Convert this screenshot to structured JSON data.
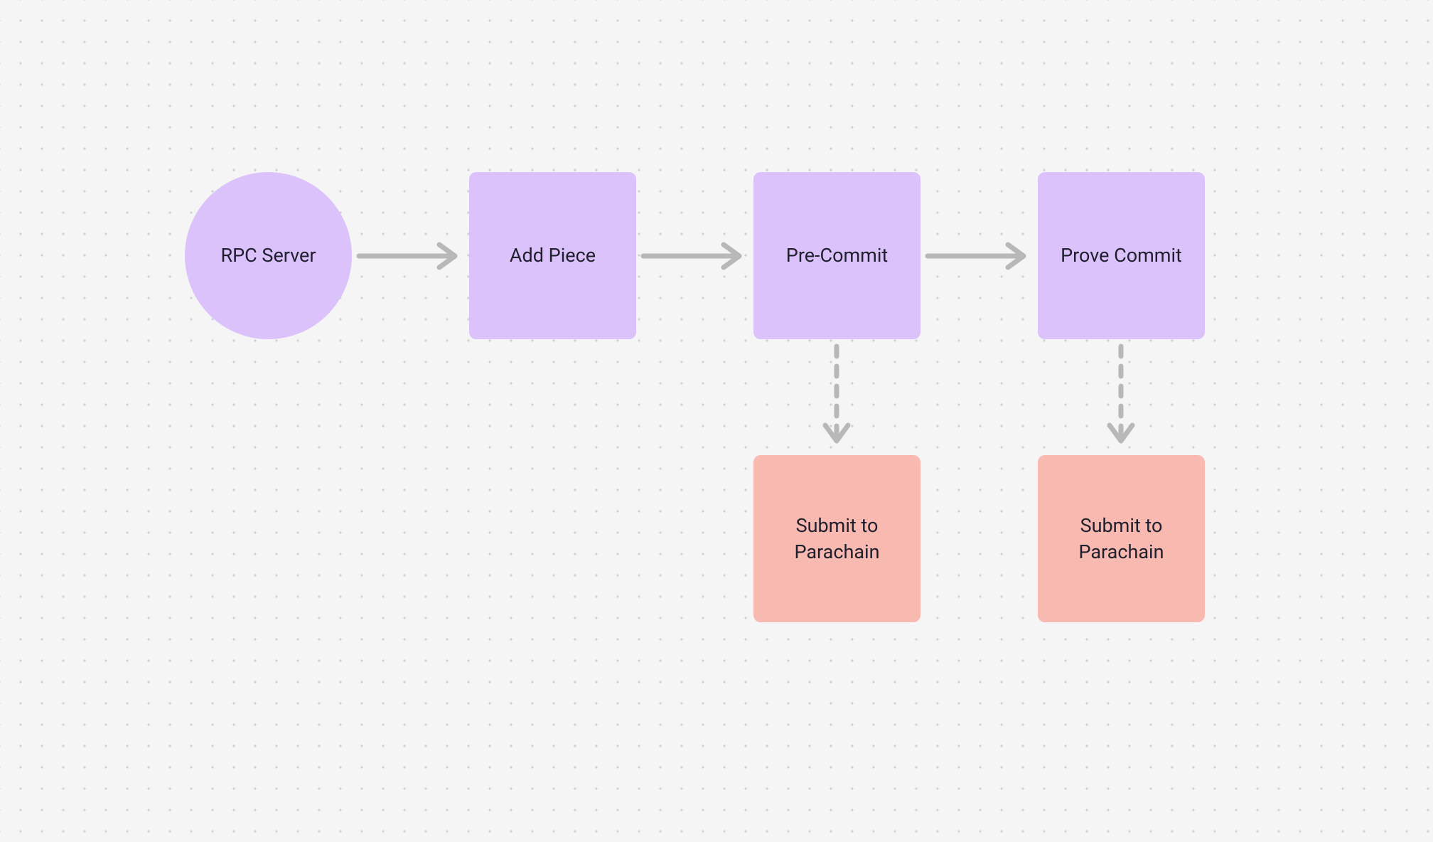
{
  "nodes": {
    "rpc": {
      "label": "RPC Server"
    },
    "addpiece": {
      "label": "Add Piece"
    },
    "precommit": {
      "label": "Pre-Commit"
    },
    "prove": {
      "label": "Prove Commit"
    },
    "submit1": {
      "label": "Submit to Parachain"
    },
    "submit2": {
      "label": "Submit to Parachain"
    }
  },
  "colors": {
    "purple": "#dcc2fb",
    "pink": "#f7b9b0",
    "arrow": "#b8b8b8",
    "text": "#1f1f2e",
    "bg": "#f5f5f5"
  }
}
